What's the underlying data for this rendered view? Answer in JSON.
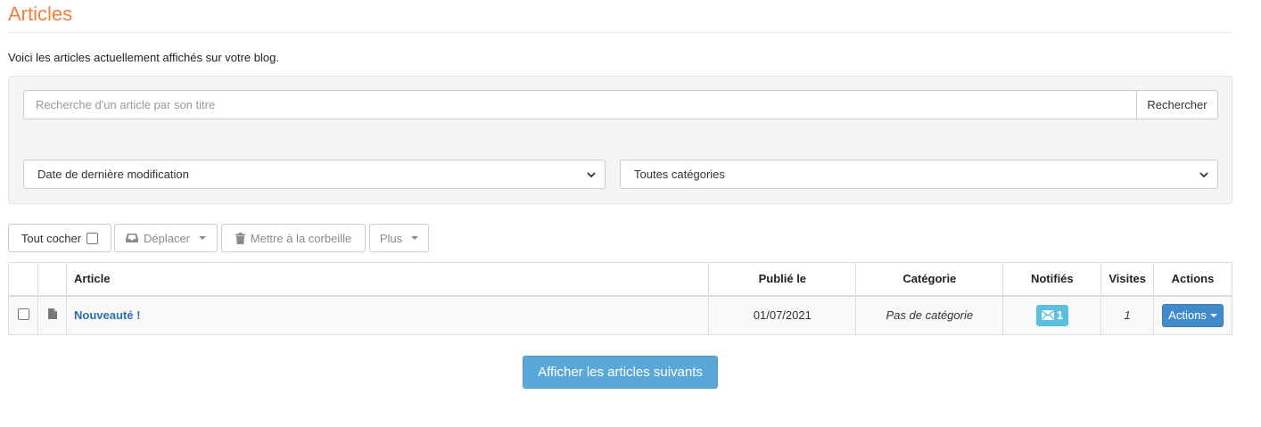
{
  "page": {
    "title": "Articles",
    "intro": "Voici les articles actuellement affichés sur votre blog."
  },
  "search": {
    "placeholder": "Recherche d'un article par son titre",
    "value": "",
    "button_label": "Rechercher"
  },
  "filters": {
    "sort_selected": "Date de dernière modification",
    "category_selected": "Toutes catégories"
  },
  "toolbar": {
    "check_all_label": "Tout cocher",
    "move_label": "Déplacer",
    "trash_label": "Mettre à la corbeille",
    "more_label": "Plus"
  },
  "table": {
    "headers": {
      "article": "Article",
      "published": "Publié le",
      "category": "Catégorie",
      "notified": "Notifiés",
      "visits": "Visites",
      "actions": "Actions"
    },
    "rows": [
      {
        "title": "Nouveauté !",
        "published": "01/07/2021",
        "category": "Pas de catégorie",
        "notified": "1",
        "visits": "1",
        "actions_label": "Actions"
      }
    ]
  },
  "load_more_label": "Afficher les articles suivants",
  "colors": {
    "title_orange": "#f0803c",
    "link_blue": "#2a6fb0",
    "info_badge": "#5bc0de",
    "primary_button": "#428bca",
    "load_more_button": "#5aa8d8"
  },
  "icons": {
    "move": "inbox-icon",
    "trash": "trash-icon",
    "row_type": "document-icon",
    "notified": "envelope-icon"
  }
}
